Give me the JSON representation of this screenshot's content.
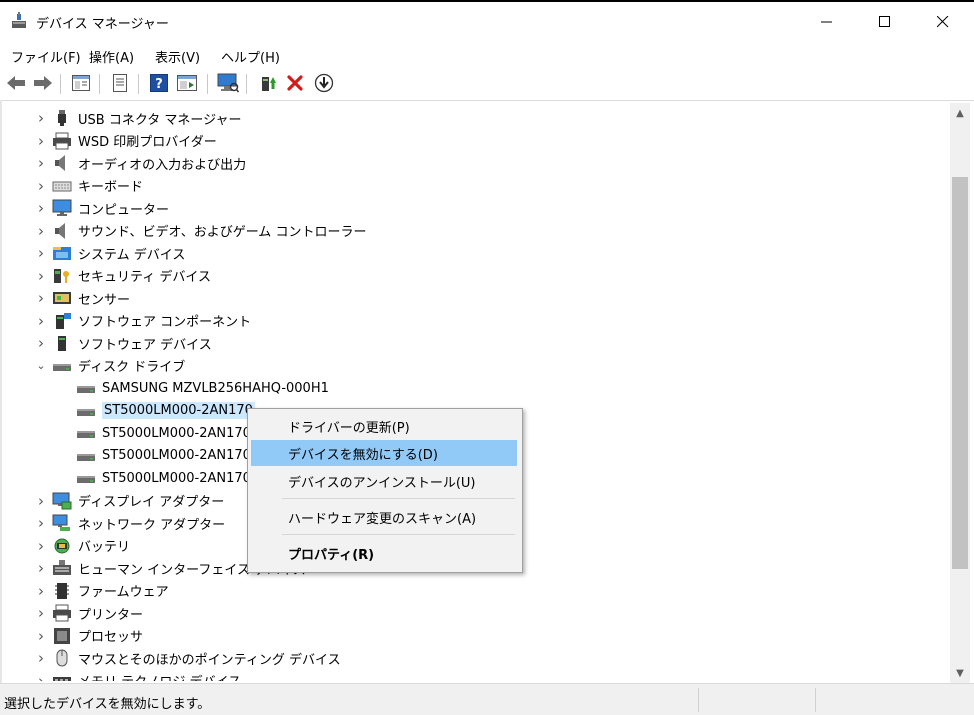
{
  "window": {
    "title": "デバイス マネージャー",
    "controls": {
      "minimize": "—",
      "maximize": "☐",
      "close": "✕"
    }
  },
  "menubar": {
    "items": [
      "ファイル(F)",
      "操作(A)",
      "表示(V)",
      "ヘルプ(H)"
    ]
  },
  "toolbar": {
    "icons": [
      "back-arrow-icon",
      "forward-arrow-icon",
      "show-hide-tree-icon",
      "properties-icon",
      "help-icon",
      "action-pane-icon",
      "monitor-scan-icon",
      "update-driver-icon",
      "uninstall-x-icon",
      "download-circle-icon"
    ]
  },
  "tree": {
    "items": [
      {
        "label": "USB コネクタ マネージャー",
        "icon": "usb-icon",
        "expanded": false
      },
      {
        "label": "WSD 印刷プロバイダー",
        "icon": "printer-icon",
        "expanded": false
      },
      {
        "label": "オーディオの入力および出力",
        "icon": "speaker-icon",
        "expanded": false
      },
      {
        "label": "キーボード",
        "icon": "keyboard-icon",
        "expanded": false
      },
      {
        "label": "コンピューター",
        "icon": "monitor-icon",
        "expanded": false
      },
      {
        "label": "サウンド、ビデオ、およびゲーム コントローラー",
        "icon": "speaker-icon",
        "expanded": false
      },
      {
        "label": "システム デバイス",
        "icon": "system-folder-icon",
        "expanded": false
      },
      {
        "label": "セキュリティ デバイス",
        "icon": "security-key-icon",
        "expanded": false
      },
      {
        "label": "センサー",
        "icon": "sensor-icon",
        "expanded": false
      },
      {
        "label": "ソフトウェア コンポーネント",
        "icon": "software-component-icon",
        "expanded": false
      },
      {
        "label": "ソフトウェア デバイス",
        "icon": "software-device-icon",
        "expanded": false
      },
      {
        "label": "ディスク ドライブ",
        "icon": "disk-drive-icon",
        "expanded": true
      },
      {
        "label": "SAMSUNG MZVLB256HAHQ-000H1",
        "icon": "disk-drive-icon",
        "child": true
      },
      {
        "label": "ST5000LM000-2AN170",
        "icon": "disk-drive-icon",
        "child": true,
        "selected": true
      },
      {
        "label": "ST5000LM000-2AN170",
        "icon": "disk-drive-icon",
        "child": true
      },
      {
        "label": "ST5000LM000-2AN170",
        "icon": "disk-drive-icon",
        "child": true
      },
      {
        "label": "ST5000LM000-2AN170",
        "icon": "disk-drive-icon",
        "child": true
      },
      {
        "label": "ディスプレイ アダプター",
        "icon": "display-adapter-icon",
        "expanded": false
      },
      {
        "label": "ネットワーク アダプター",
        "icon": "network-icon",
        "expanded": false
      },
      {
        "label": "バッテリ",
        "icon": "battery-icon",
        "expanded": false
      },
      {
        "label": "ヒューマン インターフェイス デバイス",
        "icon": "hid-icon",
        "expanded": false
      },
      {
        "label": "ファームウェア",
        "icon": "firmware-icon",
        "expanded": false
      },
      {
        "label": "プリンター",
        "icon": "printer-icon",
        "expanded": false
      },
      {
        "label": "プロセッサ",
        "icon": "processor-icon",
        "expanded": false
      },
      {
        "label": "マウスとそのほかのポインティング デバイス",
        "icon": "mouse-icon",
        "expanded": false
      },
      {
        "label": "メモリ テクノロジ デバイス",
        "icon": "memory-icon",
        "expanded": false
      }
    ]
  },
  "context_menu": {
    "items": [
      {
        "label": "ドライバーの更新(P)",
        "highlighted": false,
        "bold": false
      },
      {
        "label": "デバイスを無効にする(D)",
        "highlighted": true,
        "bold": false
      },
      {
        "label": "デバイスのアンインストール(U)",
        "highlighted": false,
        "bold": false
      },
      {
        "label": "ハードウェア変更のスキャン(A)",
        "highlighted": false,
        "bold": false
      },
      {
        "label": "プロパティ(R)",
        "highlighted": false,
        "bold": true
      }
    ]
  },
  "statusbar": {
    "text": "選択したデバイスを無効にします。"
  }
}
